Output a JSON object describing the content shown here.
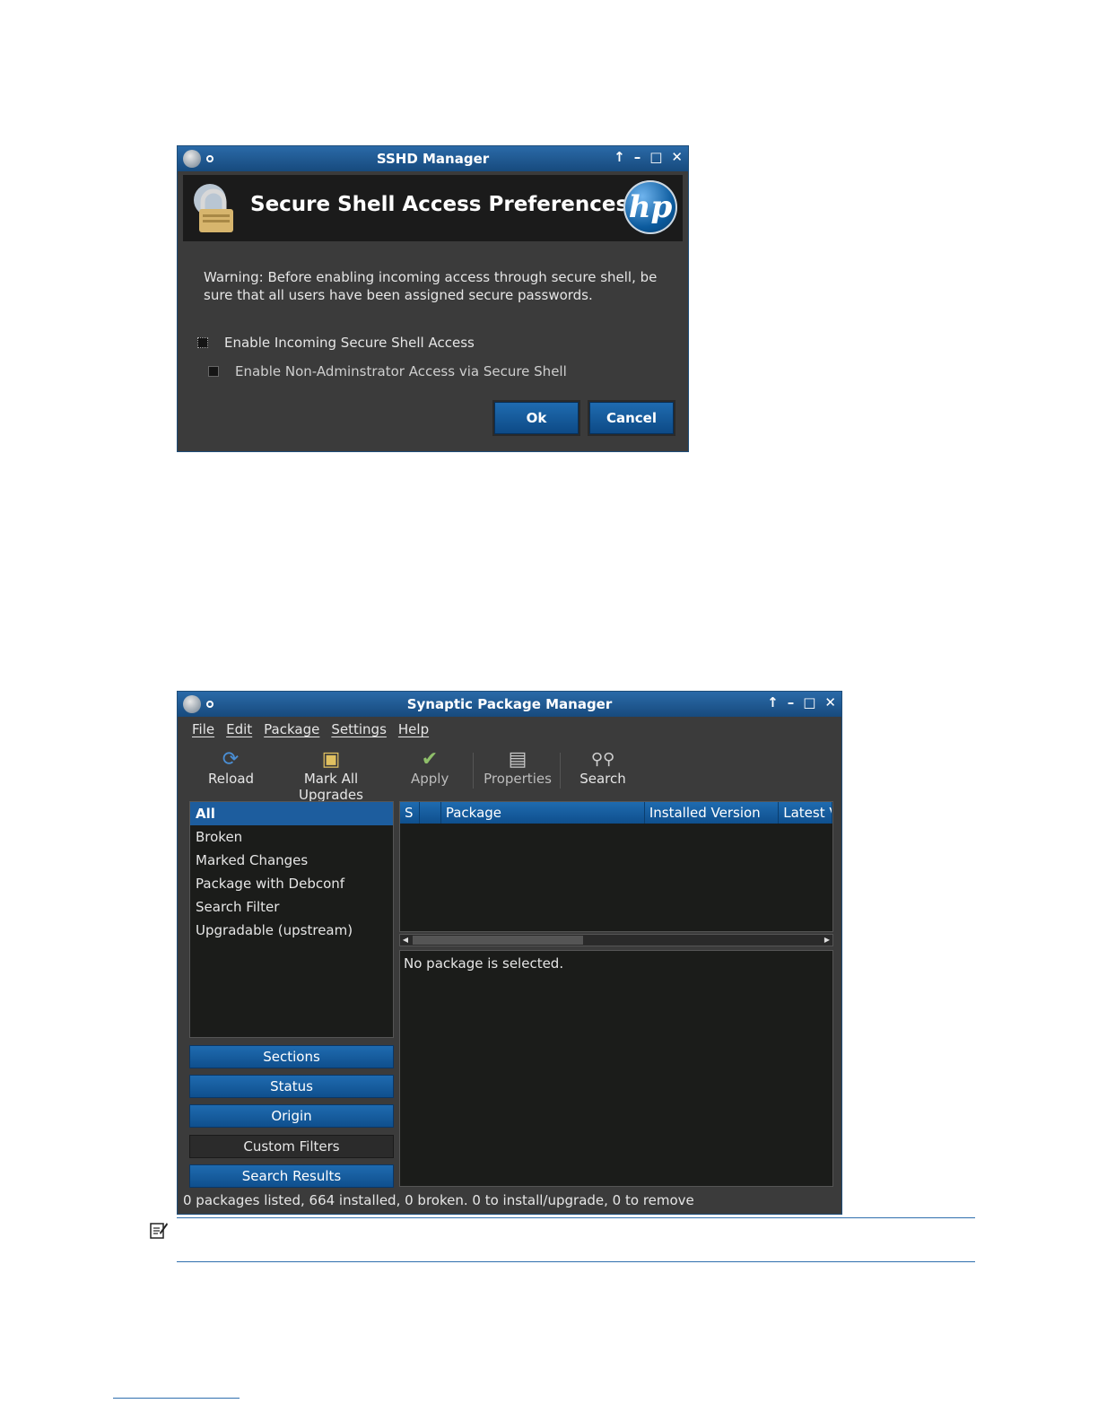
{
  "sshd": {
    "window_title": "SSHD Manager",
    "banner_title": "Secure Shell Access Preferences",
    "hp_logo": "hp",
    "warning": "Warning:  Before enabling incoming access through secure shell, be sure that all users have been assigned secure passwords.",
    "checkbox_incoming": "Enable Incoming Secure Shell Access",
    "checkbox_nonadmin": "Enable Non-Adminstrator Access via Secure Shell",
    "ok_label": "Ok",
    "cancel_label": "Cancel",
    "icons": [
      "lock-icon",
      "hp-logo"
    ]
  },
  "synaptic": {
    "window_title": "Synaptic Package Manager",
    "menu": [
      "File",
      "Edit",
      "Package",
      "Settings",
      "Help"
    ],
    "toolbar": {
      "reload": "Reload",
      "mark_all": "Mark All Upgrades",
      "apply": "Apply",
      "properties": "Properties",
      "search": "Search"
    },
    "filters": [
      "All",
      "Broken",
      "Marked Changes",
      "Package with Debconf",
      "Search Filter",
      "Upgradable (upstream)"
    ],
    "filter_buttons": {
      "sections": "Sections",
      "status": "Status",
      "origin": "Origin",
      "custom": "Custom Filters",
      "results": "Search Results"
    },
    "columns": [
      "S",
      "",
      "Package",
      "Installed Version",
      "Latest Version"
    ],
    "details_text": "No package is selected.",
    "status_text": "0 packages listed, 664 installed, 0 broken. 0 to install/upgrade, 0 to remove"
  },
  "colors": {
    "title_blue": "#1f5f9d",
    "button_blue": "#1565a8",
    "panel_dark": "#1b1c1a",
    "window_gray": "#3b3b3b"
  }
}
